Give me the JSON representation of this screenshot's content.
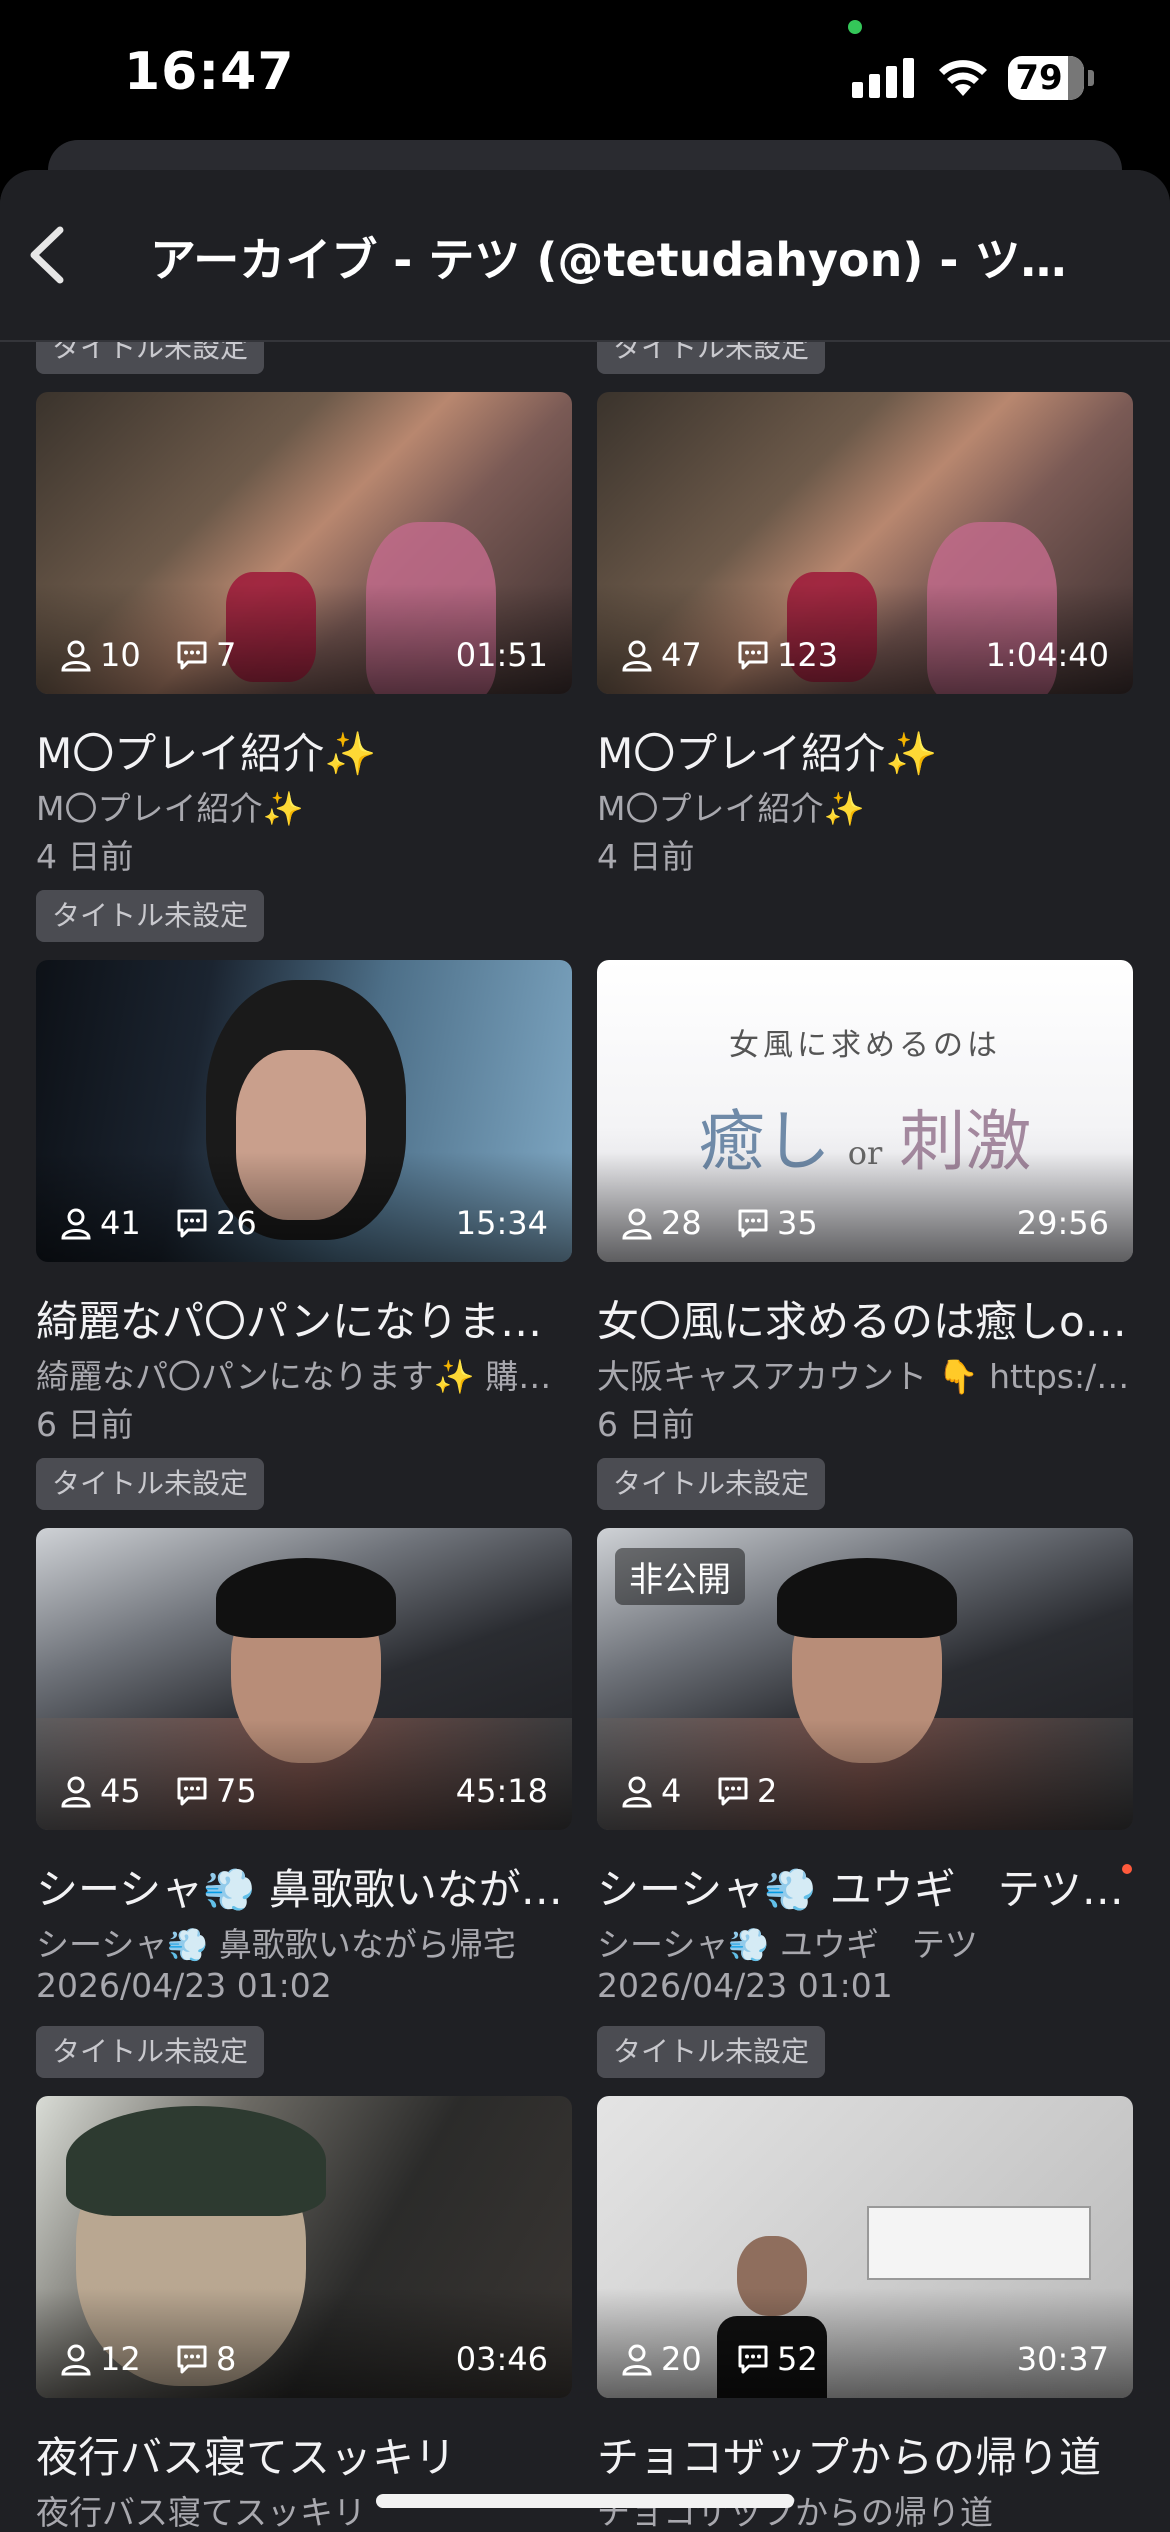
{
  "status_bar": {
    "time": "16:47",
    "battery": "79"
  },
  "nav": {
    "title": "アーカイブ - テツ (@tetudahyon) - ツイ…"
  },
  "top_tags": [
    "タイトル未設定",
    "タイトル未設定"
  ],
  "cards": [
    {
      "viewers": "10",
      "comments": "7",
      "duration": "01:51",
      "title": "M〇プレイ紹介✨",
      "subtitle": "M〇プレイ紹介✨",
      "date": "4 日前",
      "tag": "タイトル未設定",
      "private": ""
    },
    {
      "viewers": "47",
      "comments": "123",
      "duration": "1:04:40",
      "title": "M〇プレイ紹介✨",
      "subtitle": "M〇プレイ紹介✨",
      "date": "4 日前",
      "tag": "",
      "private": ""
    },
    {
      "viewers": "41",
      "comments": "26",
      "duration": "15:34",
      "title": "綺麗なパ〇パンになりま…",
      "subtitle": "綺麗なパ〇パンになります✨ 購…",
      "date": "6 日前",
      "tag": "タイトル未設定",
      "private": ""
    },
    {
      "viewers": "28",
      "comments": "35",
      "duration": "29:56",
      "title": "女〇風に求めるのは癒しo…",
      "subtitle": "大阪キャスアカウント 👇 https:/…",
      "date": "6 日前",
      "tag": "タイトル未設定",
      "private": "",
      "thumb_text": {
        "line1": "女風に求めるのは",
        "line2a": "癒し",
        "line2b": "or",
        "line2c": "刺激"
      }
    },
    {
      "viewers": "45",
      "comments": "75",
      "duration": "45:18",
      "title": "シーシャ💨 鼻歌歌いなが…",
      "subtitle": "シーシャ💨 鼻歌歌いながら帰宅",
      "date": "2026/04/23 01:02",
      "tag": "タイトル未設定",
      "private": ""
    },
    {
      "viewers": "4",
      "comments": "2",
      "duration": "",
      "title": "シーシャ💨 ユウギ　テツ…",
      "subtitle": "シーシャ💨 ユウギ　テツ",
      "date": "2026/04/23 01:01",
      "tag": "タイトル未設定",
      "private": "非公開"
    },
    {
      "viewers": "12",
      "comments": "8",
      "duration": "03:46",
      "title": "夜行バス寝てスッキリ",
      "subtitle": "夜行バス寝てスッキリ",
      "date": "",
      "tag": "",
      "private": ""
    },
    {
      "viewers": "20",
      "comments": "52",
      "duration": "30:37",
      "title": "チョコザップからの帰り道",
      "subtitle": "チョコザップからの帰り道",
      "date": "",
      "tag": "",
      "private": ""
    }
  ],
  "icons": {
    "viewer": "person-icon",
    "comment": "comment-icon",
    "back": "chevron-left-icon"
  }
}
